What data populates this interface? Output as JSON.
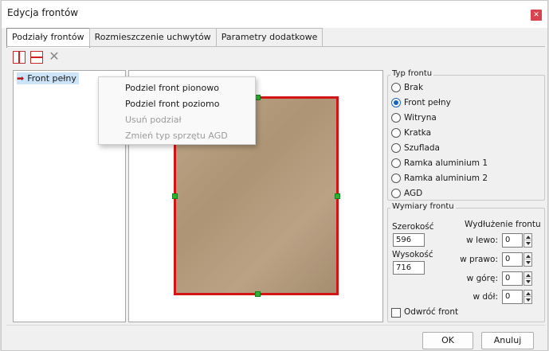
{
  "window": {
    "title": "Edycja frontów"
  },
  "tabs": [
    {
      "label": "Podziały frontów"
    },
    {
      "label": "Rozmieszczenie uchwytów"
    },
    {
      "label": "Parametry dodatkowe"
    }
  ],
  "toolbar": {
    "icons": [
      "split-vertical-icon",
      "split-horizontal-icon",
      "remove-icon"
    ]
  },
  "tree": {
    "items": [
      {
        "label": "Front pełny"
      }
    ]
  },
  "context_menu": {
    "items": [
      {
        "label": "Podziel front pionowo",
        "enabled": true
      },
      {
        "label": "Podziel front poziomo",
        "enabled": true
      },
      {
        "label": "Usuń podział",
        "enabled": false
      },
      {
        "label": "Zmień typ sprzętu AGD",
        "enabled": false
      }
    ]
  },
  "typ_frontu": {
    "legend": "Typ frontu",
    "options": [
      "Brak",
      "Front pełny",
      "Witryna",
      "Kratka",
      "Szuflada",
      "Ramka aluminium 1",
      "Ramka aluminium 2",
      "AGD"
    ],
    "selected": "Front pełny"
  },
  "wymiary": {
    "legend": "Wymiary frontu",
    "szerokosc_label": "Szerokość",
    "szerokosc_value": "596",
    "wysokosc_label": "Wysokość",
    "wysokosc_value": "716",
    "wydluzenie_label": "Wydłużenie frontu",
    "spinners": [
      {
        "label": "w lewo:",
        "value": "0"
      },
      {
        "label": "w prawo:",
        "value": "0"
      },
      {
        "label": "w górę:",
        "value": "0"
      },
      {
        "label": "w dół:",
        "value": "0"
      }
    ]
  },
  "odwroc": {
    "label": "Odwróć front",
    "checked": false
  },
  "buttons": {
    "ok": "OK",
    "cancel": "Anuluj"
  },
  "colors": {
    "accent": "#1565c0",
    "frame": "#d41414",
    "handle": "#27b52a",
    "close": "#d9434e"
  }
}
